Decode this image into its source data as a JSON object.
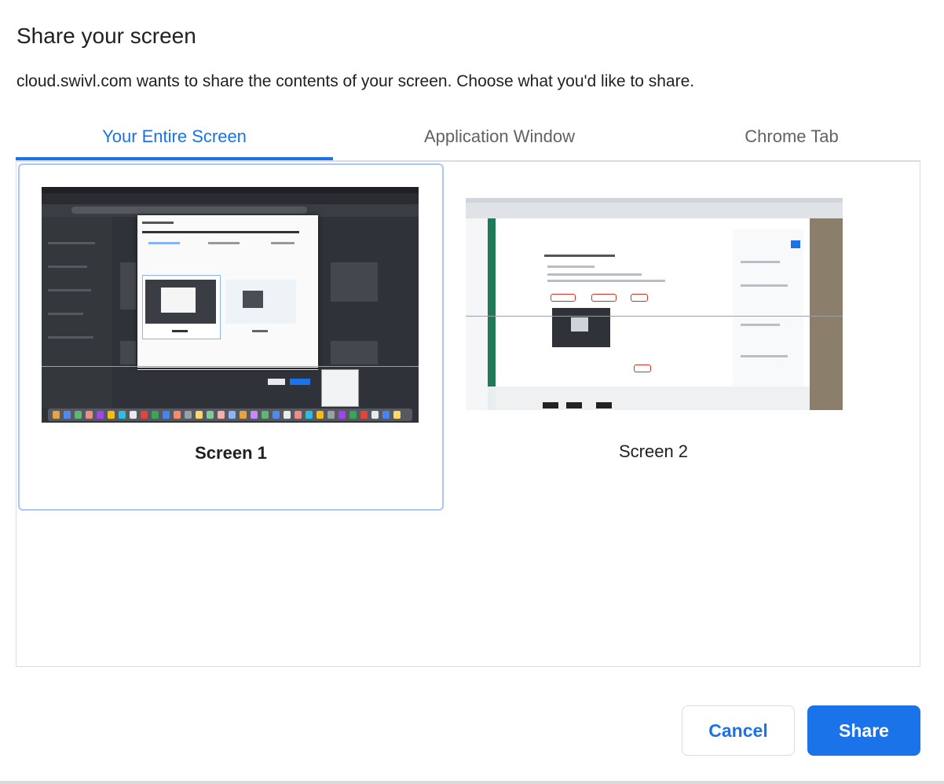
{
  "dialog": {
    "title": "Share your screen",
    "subtitle": "cloud.swivl.com wants to share the contents of your screen. Choose what you'd like to share."
  },
  "tabs": [
    {
      "label": "Your Entire Screen",
      "active": true
    },
    {
      "label": "Application Window",
      "active": false
    },
    {
      "label": "Chrome Tab",
      "active": false
    }
  ],
  "sources": [
    {
      "label": "Screen 1",
      "selected": true
    },
    {
      "label": "Screen 2",
      "selected": false
    }
  ],
  "buttons": {
    "cancel_label": "Cancel",
    "share_label": "Share"
  },
  "colors": {
    "accent": "#1a73e8",
    "selection_border": "#a8c7fa",
    "text": "#202124",
    "muted": "#5f6368"
  }
}
